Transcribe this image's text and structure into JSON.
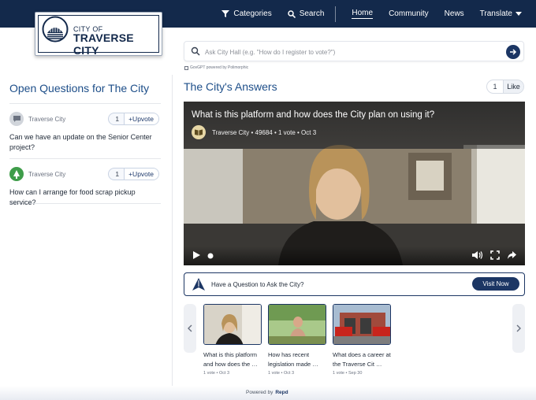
{
  "nav": {
    "categories": "Categories",
    "search": "Search",
    "home": "Home",
    "community": "Community",
    "news": "News",
    "translate": "Translate"
  },
  "logo": {
    "line1": "CITY OF",
    "line2": "TRAVERSE CITY"
  },
  "search": {
    "placeholder": "Ask City Hall (e.g. \"How do I register to vote?\")",
    "powered": "GovGPT powered by Polimorphic"
  },
  "open_questions": {
    "title": "Open Questions for The City",
    "items": [
      {
        "author": "Traverse City",
        "count": "1",
        "upvote": "+Upvote",
        "text": "Can we have an update on the Senior Center project?",
        "avatar_color": "#9ca3af",
        "avatar_icon": "chat-bubble-icon"
      },
      {
        "author": "Traverse City",
        "count": "1",
        "upvote": "+Upvote",
        "text": "How can I arrange for food scrap pickup service?",
        "avatar_color": "#3f9d4a",
        "avatar_icon": "tree-icon"
      }
    ]
  },
  "answers": {
    "title": "The City's Answers",
    "like_count": "1",
    "like_label": "Like"
  },
  "video": {
    "title": "What is this platform and how does the City plan on using it?",
    "meta": "Traverse City • 49684 • 1 vote • Oct 3"
  },
  "ask": {
    "text": "Have a Question to Ask the City?",
    "button": "Visit Now"
  },
  "carousel": [
    {
      "title": "What is this platform and how does the …",
      "meta": "1 vote  • Oct 3"
    },
    {
      "title": "How has recent legislation made …",
      "meta": "1 vote  • Oct 3"
    },
    {
      "title": "What does a career at the Traverse Cit …",
      "meta": "1 vote  • Sep 30"
    }
  ],
  "footer": {
    "powered_by": "Powered by",
    "brand": "Repd"
  },
  "colors": {
    "navy": "#13294b",
    "accent": "#1c3664",
    "title_blue": "#1d4e89"
  }
}
